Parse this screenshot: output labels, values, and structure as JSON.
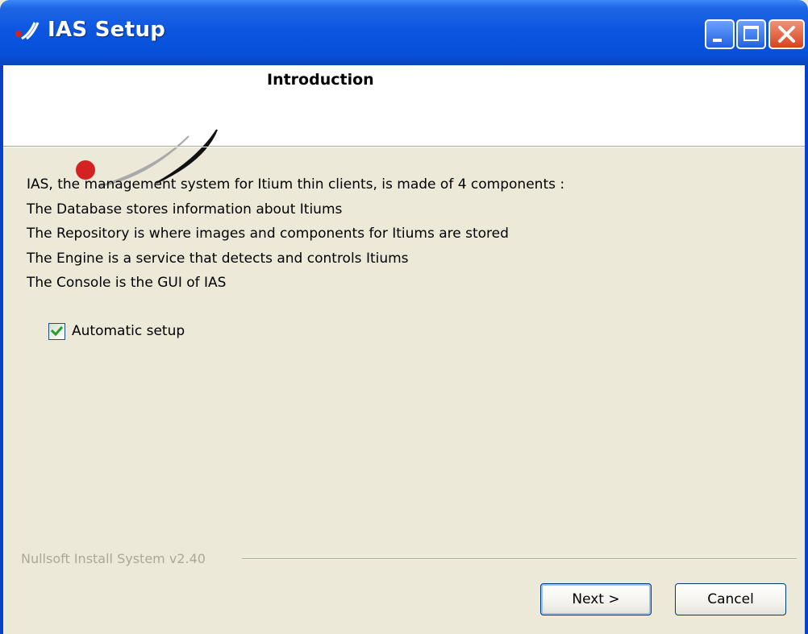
{
  "window": {
    "title": "IAS Setup",
    "controls": [
      "minimize",
      "maximize",
      "close"
    ]
  },
  "header": {
    "title": "Introduction"
  },
  "intro": {
    "lines": [
      "IAS, the management system for Itium thin clients, is made of 4 components :",
      "The Database stores information about Itiums",
      "The Repository is where images and components for Itiums are stored",
      "The Engine is a service that detects and controls Itiums",
      "The Console is the GUI of IAS"
    ]
  },
  "options": {
    "automatic_setup_label": "Automatic setup",
    "automatic_setup_checked": true
  },
  "branding": {
    "text": "Nullsoft Install System v2.40"
  },
  "buttons": {
    "next_label": "Next >",
    "cancel_label": "Cancel"
  },
  "colors": {
    "titlebar": "#0a54e0",
    "dialog_bg": "#ece9d8",
    "logo_red": "#d42222",
    "checkmark": "#21a121"
  }
}
